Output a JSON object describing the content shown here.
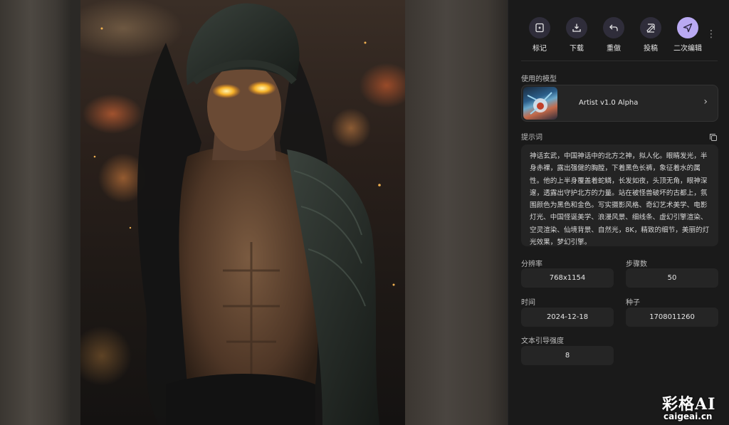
{
  "toolbar": {
    "items": [
      {
        "label": "标记",
        "icon": "bookmark-icon"
      },
      {
        "label": "下载",
        "icon": "download-icon"
      },
      {
        "label": "重做",
        "icon": "undo-icon"
      },
      {
        "label": "投稿",
        "icon": "submit-icon"
      },
      {
        "label": "二次编辑",
        "icon": "send-icon"
      }
    ],
    "more_icon": "more-vertical-icon"
  },
  "model": {
    "section_label": "使用的模型",
    "name": "Artist v1.0 Alpha"
  },
  "prompt": {
    "section_label": "提示词",
    "text": "神话玄武，中国神话中的北方之神，拟人化。眼睛发光，半身赤裸，露出强健的胸膛，下着黑色长裤，象征着水的属性。他的上半身覆盖着蛇鳞，长发如夜，头顶无角，眼神深邃，透露出守护北方的力量。站在被怪兽破坏的古都上，氛围颜色为黑色和金色。写实摄影风格、奇幻艺术美学、电影灯光、中国怪诞美学、浪漫风景、细线条、虚幻引擎渲染、空灵渲染、仙境背景、自然光，8K，精致的细节，美丽的灯光效果，梦幻引擎。"
  },
  "params": {
    "resolution_label": "分辨率",
    "resolution": "768x1154",
    "steps_label": "步骤数",
    "steps": "50",
    "time_label": "时间",
    "time": "2024-12-18",
    "seed_label": "种子",
    "seed": "1708011260",
    "guidance_label": "文本引导强度",
    "guidance": "8"
  },
  "watermark": {
    "brand": "彩格AI",
    "url": "caigeai.cn"
  },
  "colors": {
    "panel_bg": "#1a1a1a",
    "accent": "#b9a9f2",
    "icon_circle": "#2f2d3a"
  }
}
